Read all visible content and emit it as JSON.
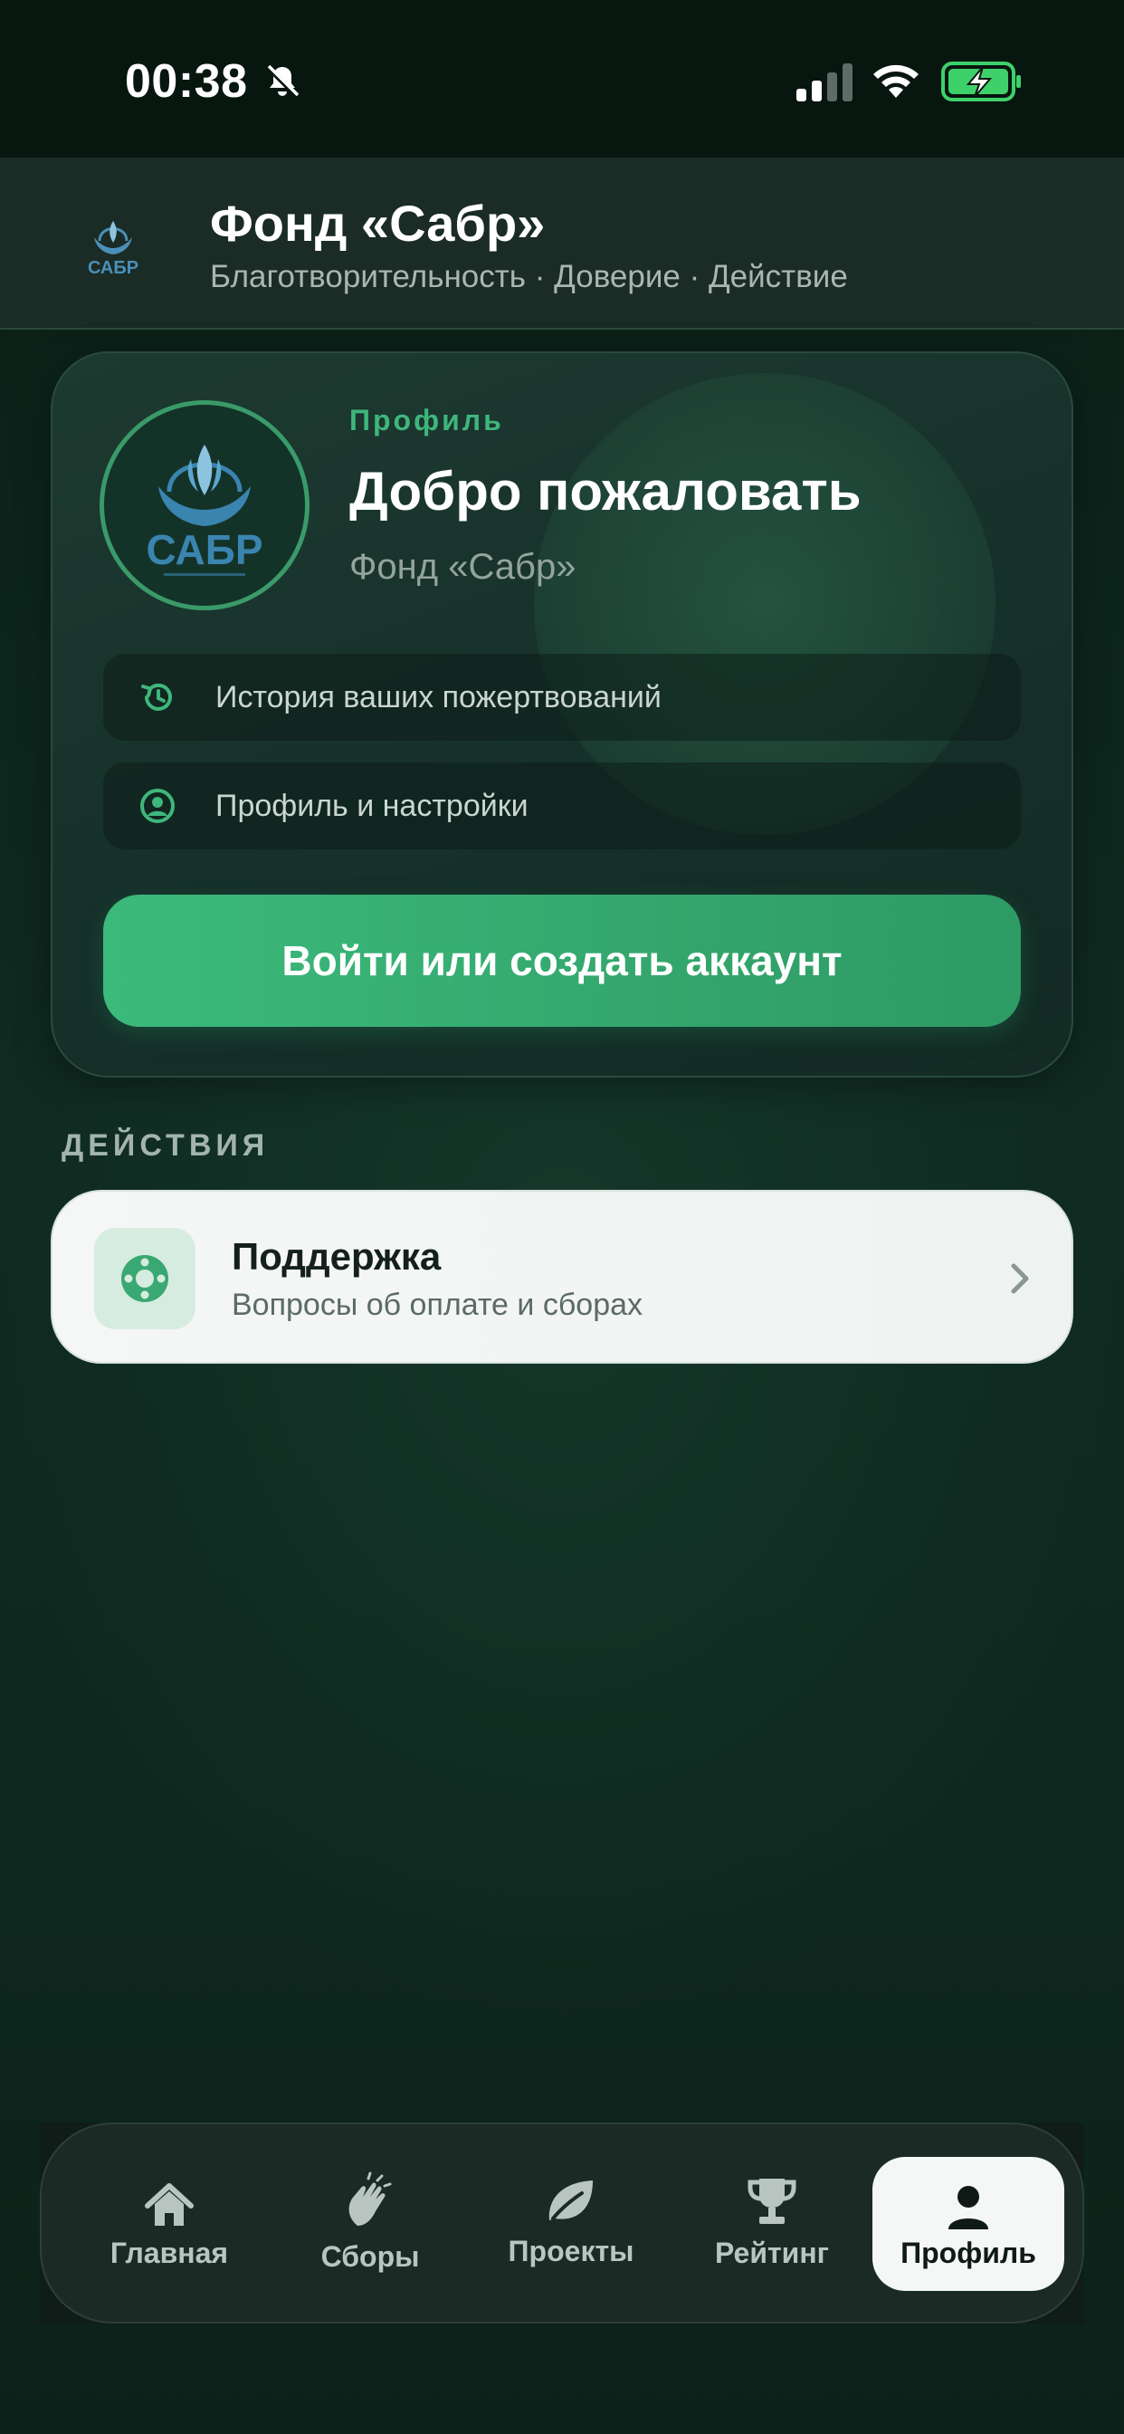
{
  "status_bar": {
    "time": "00:38"
  },
  "header": {
    "title": "Фонд «Сабр»",
    "subtitle": "Благотворительность · Доверие · Действие"
  },
  "profile_card": {
    "tag": "Профиль",
    "welcome": "Добро пожаловать",
    "fund_name": "Фонд «Сабр»",
    "rows": [
      {
        "label": "История ваших пожертвований",
        "icon": "history-icon"
      },
      {
        "label": "Профиль и настройки",
        "icon": "user-circle-icon"
      }
    ],
    "login_button": "Войти или создать аккаунт"
  },
  "actions": {
    "section_title": "ДЕЙСТВИЯ",
    "support": {
      "title": "Поддержка",
      "subtitle": "Вопросы об оплате и сборах",
      "icon": "lifebuoy-icon"
    }
  },
  "tabs": [
    {
      "label": "Главная",
      "icon": "home-icon"
    },
    {
      "label": "Сборы",
      "icon": "clapping-hands-icon"
    },
    {
      "label": "Проекты",
      "icon": "leaf-icon"
    },
    {
      "label": "Рейтинг",
      "icon": "trophy-icon"
    },
    {
      "label": "Профиль",
      "icon": "person-icon",
      "active": true
    }
  ],
  "colors": {
    "accent": "#3cba7b",
    "background": "#0e281f",
    "card": "#1a352c"
  }
}
